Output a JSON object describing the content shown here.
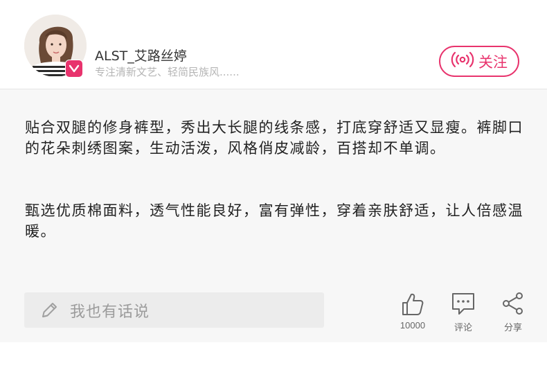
{
  "author": {
    "name": "ALST_艾路丝婷",
    "description": "专注清新文艺、轻简民族风......"
  },
  "follow": {
    "label": "关注"
  },
  "post": {
    "paragraphs": [
      "贴合双腿的修身裤型，秀出大长腿的线条感，打底穿舒适又显瘦。裤脚口的花朵刺绣图案，生动活泼，风格俏皮减龄，百搭却不单调。",
      "甄选优质棉面料，透气性能良好，富有弹性，穿着亲肤舒适，让人倍感温暖。"
    ]
  },
  "comment_input": {
    "placeholder": "我也有话说"
  },
  "actions": {
    "like": {
      "count": "10000",
      "icon": "thumbs-up-icon"
    },
    "comment": {
      "label": "评论",
      "icon": "comment-bubble-icon"
    },
    "share": {
      "label": "分享",
      "icon": "share-icon"
    }
  },
  "colors": {
    "accent": "#e8336d",
    "content_bg": "#f7f7f7",
    "input_bg": "#ececec"
  }
}
